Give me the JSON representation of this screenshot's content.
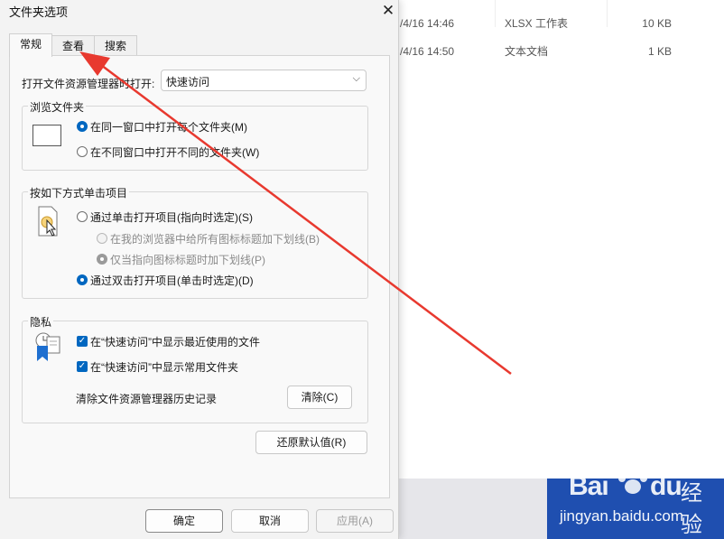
{
  "explorer": {
    "rows": [
      {
        "date": "/4/16 14:46",
        "type": "XLSX 工作表",
        "size": "10 KB"
      },
      {
        "date": "/4/16 14:50",
        "type": "文本文档",
        "size": "1 KB"
      }
    ]
  },
  "watermark": {
    "brand": "Bai",
    "brand2": "du",
    "cn": "经验",
    "url": "jingyan.baidu.com"
  },
  "dialog": {
    "title": "文件夹选项",
    "close": "✕",
    "tabs": [
      {
        "label": "常规"
      },
      {
        "label": "查看"
      },
      {
        "label": "搜索"
      }
    ],
    "open_explorer_label": "打开文件资源管理器时打开:",
    "open_explorer_value": "快速访问",
    "browse_group": {
      "title": "浏览文件夹",
      "opt_same": "在同一窗口中打开每个文件夹(M)",
      "opt_new": "在不同窗口中打开不同的文件夹(W)"
    },
    "click_group": {
      "title": "按如下方式单击项目",
      "opt_single": "通过单击打开项目(指向时选定)(S)",
      "opt_underline_all": "在我的浏览器中给所有图标标题加下划线(B)",
      "opt_underline_point": "仅当指向图标标题时加下划线(P)",
      "opt_double": "通过双击打开项目(单击时选定)(D)"
    },
    "privacy_group": {
      "title": "隐私",
      "chk_recent": "在“快速访问”中显示最近使用的文件",
      "chk_frequent": "在“快速访问”中显示常用文件夹",
      "clear_label": "清除文件资源管理器历史记录",
      "clear_btn": "清除(C)"
    },
    "restore_btn": "还原默认值(R)",
    "ok_btn": "确定",
    "cancel_btn": "取消",
    "apply_btn": "应用(A)"
  },
  "colors": {
    "accent": "#0067c0",
    "annotation": "#e8392f"
  }
}
